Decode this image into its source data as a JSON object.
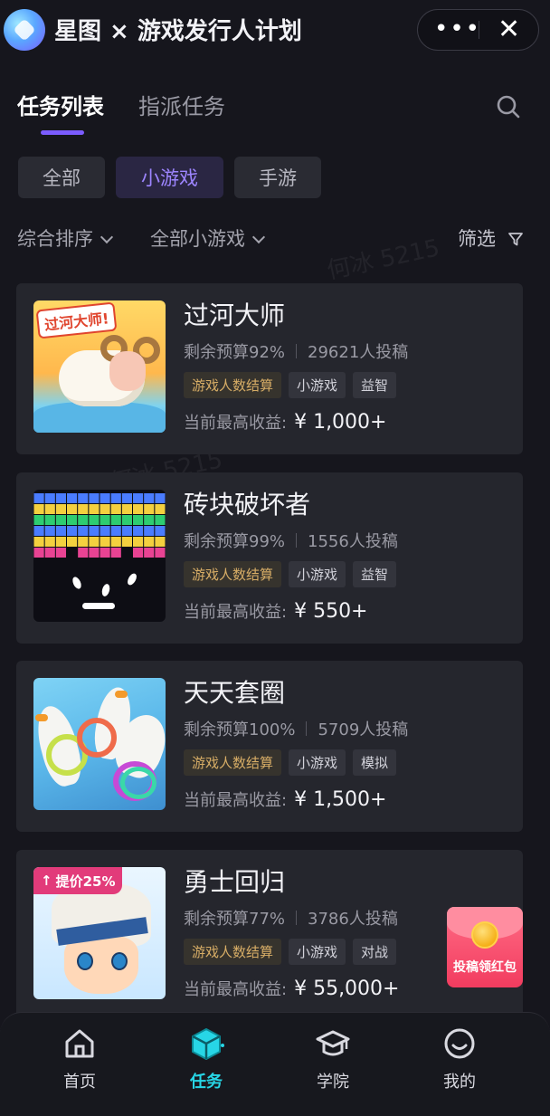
{
  "header": {
    "title": "星图 × 游戏发行人计划",
    "more_label": "•••",
    "close_label": "✕"
  },
  "tabs": [
    {
      "label": "任务列表",
      "active": true
    },
    {
      "label": "指派任务",
      "active": false
    }
  ],
  "chips": [
    {
      "label": "全部",
      "active": false
    },
    {
      "label": "小游戏",
      "active": true
    },
    {
      "label": "手游",
      "active": false
    }
  ],
  "sort": {
    "order_label": "综合排序",
    "category_label": "全部小游戏",
    "filter_label": "筛选"
  },
  "income_label": "当前最高收益:",
  "games": [
    {
      "name": "过河大师",
      "budget": "剩余预算92%",
      "submissions": "29621人投稿",
      "tags": [
        "游戏人数结算",
        "小游戏",
        "益智"
      ],
      "income": "¥ 1,000+",
      "thumb_text": "过河大师!"
    },
    {
      "name": "砖块破坏者",
      "budget": "剩余预算99%",
      "submissions": "1556人投稿",
      "tags": [
        "游戏人数结算",
        "小游戏",
        "益智"
      ],
      "income": "¥ 550+"
    },
    {
      "name": "天天套圈",
      "budget": "剩余预算100%",
      "submissions": "5709人投稿",
      "tags": [
        "游戏人数结算",
        "小游戏",
        "模拟"
      ],
      "income": "¥ 1,500+"
    },
    {
      "name": "勇士回归",
      "budget": "剩余预算77%",
      "submissions": "3786人投稿",
      "tags": [
        "游戏人数结算",
        "小游戏",
        "对战"
      ],
      "income": "¥ 55,000+",
      "badge": "提价25%"
    }
  ],
  "redpacket": {
    "label": "投稿领红包"
  },
  "bottom_nav": [
    {
      "label": "首页",
      "icon": "home-icon",
      "active": false
    },
    {
      "label": "任务",
      "icon": "task-cube-icon",
      "active": true
    },
    {
      "label": "学院",
      "icon": "graduation-cap-icon",
      "active": false
    },
    {
      "label": "我的",
      "icon": "smile-face-icon",
      "active": false
    }
  ],
  "watermark": "何冰 5215",
  "colors": {
    "accent_purple": "#7b5cff",
    "active_nav": "#27d6e6",
    "tag_gold": "#d7ad66",
    "card_bg": "#25262d",
    "page_bg": "#16161d"
  }
}
